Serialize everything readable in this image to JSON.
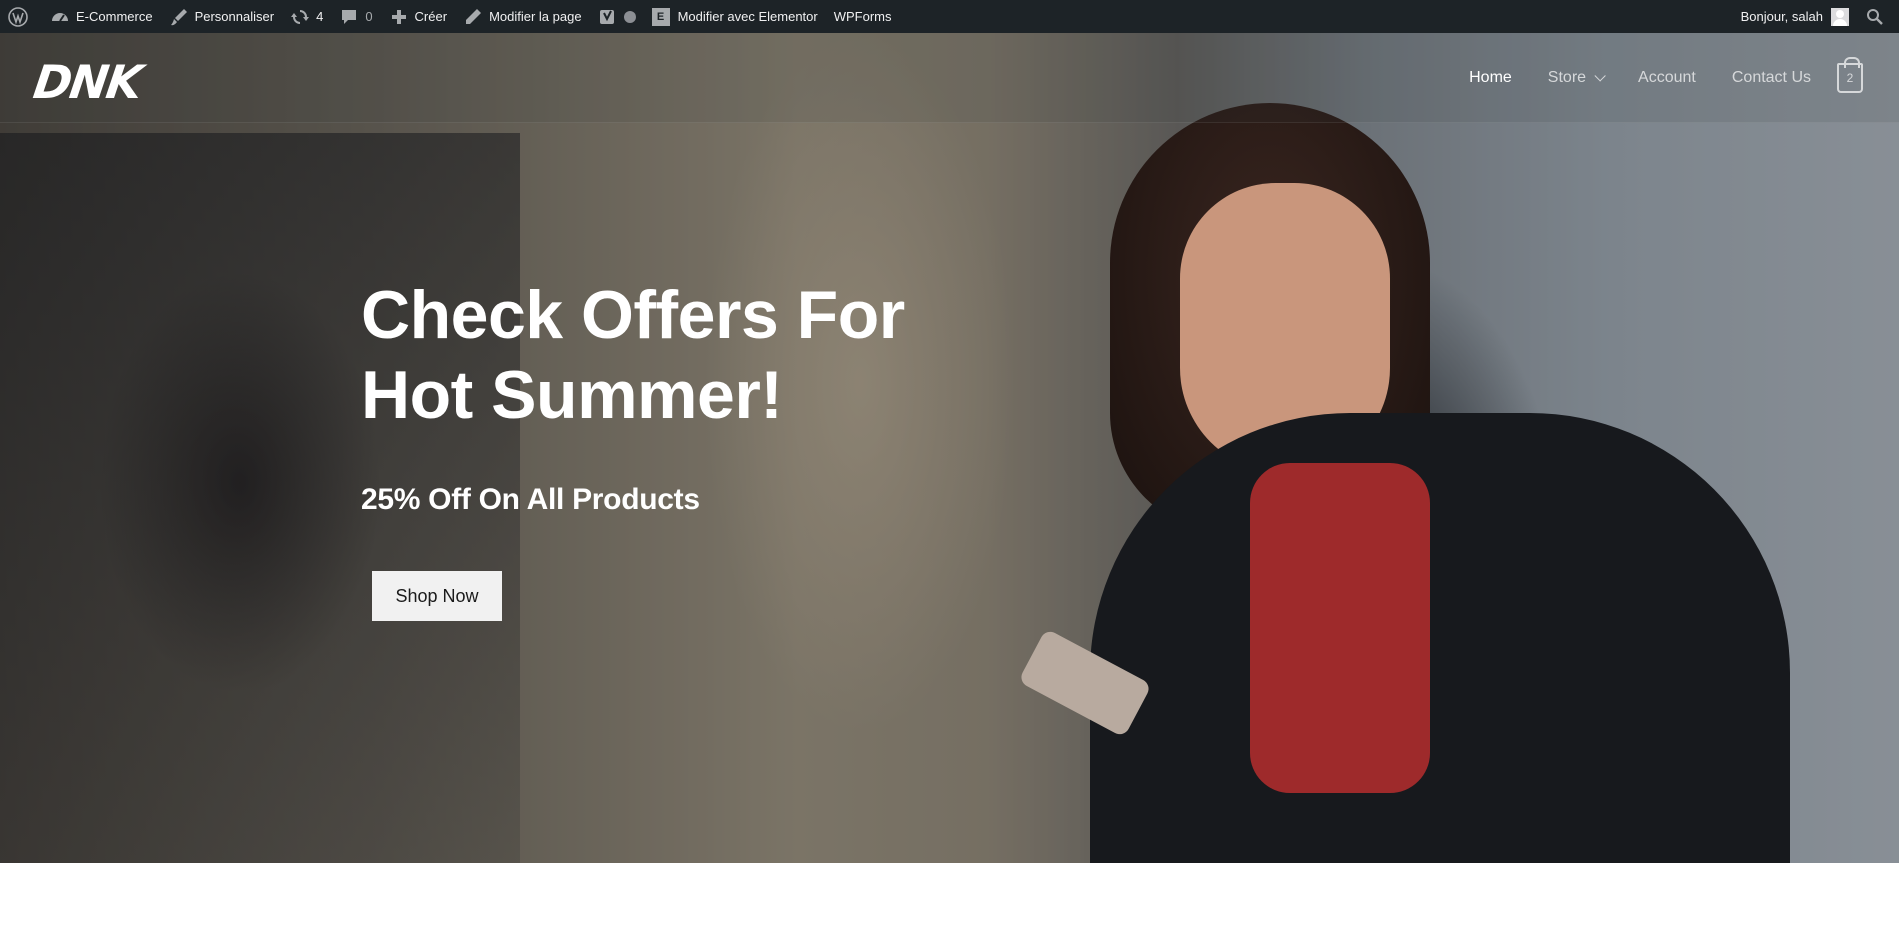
{
  "admin_bar": {
    "site_name": "E-Commerce",
    "customize": "Personnaliser",
    "updates_count": "4",
    "comments_count": "0",
    "new": "Créer",
    "edit_page": "Modifier la page",
    "elementor": "Modifier avec Elementor",
    "wpforms": "WPForms",
    "greeting": "Bonjour, salah"
  },
  "header": {
    "logo": "DNK",
    "nav": [
      "Home",
      "Store",
      "Account",
      "Contact Us"
    ],
    "cart_count": "2"
  },
  "hero": {
    "title": "Check Offers For Hot Summer!",
    "subtitle": "25% Off On All Products",
    "button": "Shop Now"
  }
}
